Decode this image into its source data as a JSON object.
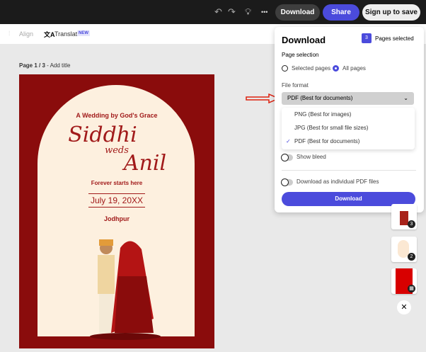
{
  "topbar": {
    "undo_icon": "undo-icon",
    "redo_icon": "redo-icon",
    "bulb_icon": "lightbulb-icon",
    "more": "•••",
    "download": "Download",
    "share": "Share",
    "signup": "Sign up to save"
  },
  "toolbar": {
    "align": "Align",
    "translate": "Translate",
    "new_badge": "NEW"
  },
  "page_label": {
    "page": "Page 1 / 3",
    "sep": " - ",
    "title": "Add title"
  },
  "card": {
    "top": "A Wedding by God's Grace",
    "name1": "Siddhi",
    "weds": "weds",
    "name2": "Anil",
    "tagline": "Forever starts here",
    "date": "July 19, 20XX",
    "place": "Jodhpur"
  },
  "panel": {
    "title": "Download",
    "pages_count": "3",
    "pages_selected": "Pages selected",
    "page_selection": "Page selection",
    "opt_selected": "Selected pages",
    "opt_all": "All pages",
    "file_format": "File format",
    "format_value": "PDF (Best for documents)",
    "menu": [
      "PNG (Best for images)",
      "JPG (Best for small file sizes)",
      "PDF (Best for documents)"
    ],
    "show_bleed": "Show bleed",
    "individual": "Download as individual PDF files",
    "download": "Download"
  },
  "thumbs": [
    "3",
    "2",
    ""
  ],
  "colors": {
    "accent": "#4b4bdc",
    "card_red": "#8a0c0c",
    "cream": "#fdf0df"
  }
}
